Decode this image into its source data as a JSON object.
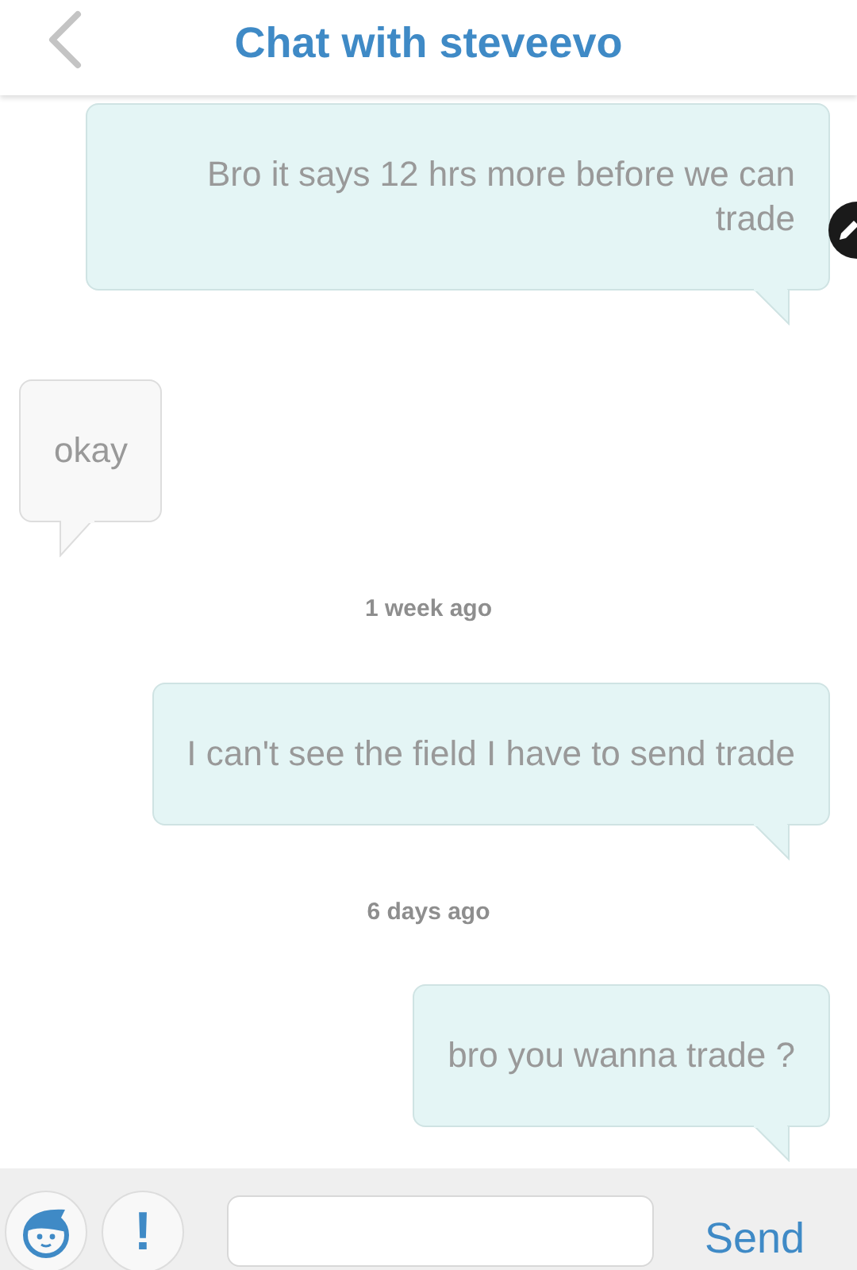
{
  "header": {
    "title": "Chat with steveevo"
  },
  "messages": [
    {
      "kind": "sent",
      "text": "Bro it says 12 hrs more before we can trade",
      "edit_badge": true
    },
    {
      "kind": "received",
      "text": "okay",
      "edit_badge": false
    },
    {
      "kind": "time",
      "text": "1 week ago"
    },
    {
      "kind": "sent",
      "text": "I can't see the field I have to send trade",
      "edit_badge": false
    },
    {
      "kind": "time",
      "text": "6 days ago"
    },
    {
      "kind": "sent",
      "text": "bro you wanna trade ?",
      "edit_badge": false
    }
  ],
  "composer": {
    "send_label": "Send",
    "alert_label": "!"
  }
}
